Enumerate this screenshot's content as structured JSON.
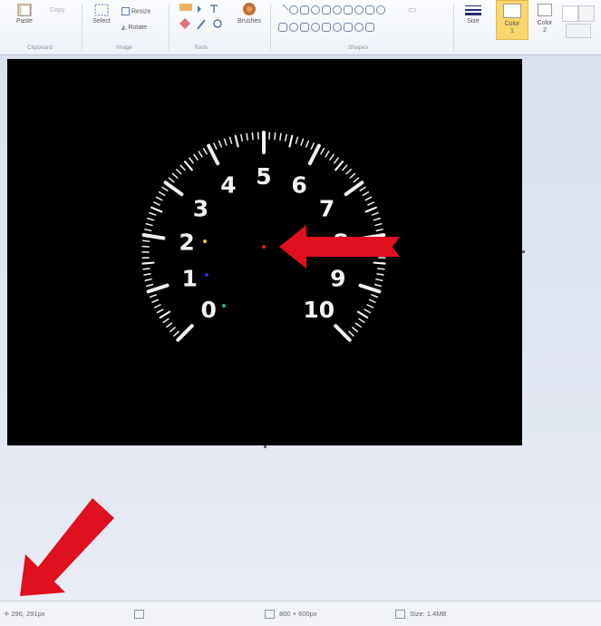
{
  "ribbon": {
    "clipboard": {
      "paste_label": "Paste",
      "copy_label": "Copy",
      "group_label": "Clipboard"
    },
    "image": {
      "select_label": "Select",
      "resize_label": "Resize",
      "rotate_label": "Rotate",
      "group_label": "Image"
    },
    "tools": {
      "group_label": "Tools"
    },
    "brushes_label": "Brushes",
    "shapes": {
      "group_label": "Shapes"
    },
    "size_label": "Size",
    "color1_label": "Color",
    "color1_num": "1",
    "color2_label": "Color",
    "color2_num": "2"
  },
  "canvas": {
    "tachometer": {
      "numbers": [
        "0",
        "1",
        "2",
        "3",
        "4",
        "5",
        "6",
        "7",
        "8",
        "9",
        "10"
      ]
    }
  },
  "statusbar": {
    "cursor_position": "296, 291px",
    "canvas_size": "800 × 600px",
    "file_size": "Size: 1.4MB"
  },
  "colors": {
    "canvas_bg": "#000000",
    "arrow": "#e0101e",
    "color1_swatch": "#f5c842",
    "dot_red": "#e02020",
    "dot_yellow": "#d8d020",
    "dot_blue": "#3030e0",
    "dot_green": "#20c060"
  }
}
